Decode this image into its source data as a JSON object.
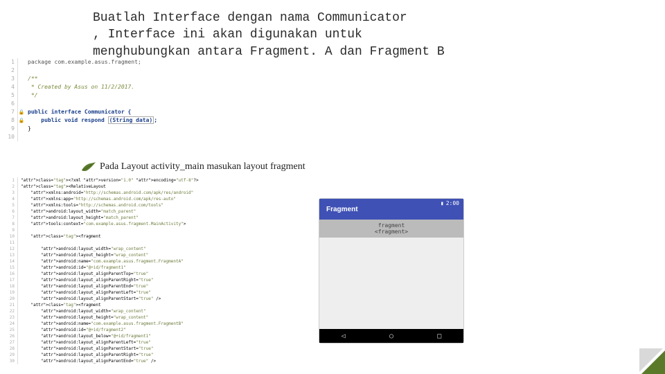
{
  "heading_lines": [
    "Buatlah Interface dengan nama Communicator",
    ", Interface ini akan digunakan untuk",
    "menghubungkan antara Fragment. A dan Fragment B"
  ],
  "subheading": "Pada Layout activity_main masukan layout fragment",
  "code1": {
    "lines": [
      {
        "n": "1",
        "icons": "",
        "txt": "package com.example.asus.fragment;",
        "cls": "pkgline"
      },
      {
        "n": "2",
        "icons": "",
        "txt": "",
        "cls": ""
      },
      {
        "n": "3",
        "icons": "",
        "txt": "/**",
        "cls": "cm"
      },
      {
        "n": "4",
        "icons": "",
        "txt": " * Created by Asus on 11/2/2017.",
        "cls": "cm"
      },
      {
        "n": "5",
        "icons": "",
        "txt": " */",
        "cls": "cm"
      },
      {
        "n": "6",
        "icons": "",
        "txt": "",
        "cls": ""
      },
      {
        "n": "7",
        "icons": "🔒▸",
        "txt": "public interface Communicator {",
        "cls": "kw"
      },
      {
        "n": "8",
        "icons": "🔒",
        "txt": "    public void respond (String data);",
        "cls": "kw",
        "boxed": true
      },
      {
        "n": "9",
        "icons": "",
        "txt": "}",
        "cls": ""
      },
      {
        "n": "10",
        "icons": "",
        "txt": "",
        "cls": ""
      }
    ]
  },
  "code2": {
    "lines": [
      "<?xml version=\"1.0\" encoding=\"utf-8\"?>",
      "<RelativeLayout",
      "    xmlns:android=\"http://schemas.android.com/apk/res/android\"",
      "    xmlns:app=\"http://schemas.android.com/apk/res-auto\"",
      "    xmlns:tools=\"http://schemas.android.com/tools\"",
      "    android:layout_width=\"match_parent\"",
      "    android:layout_height=\"match_parent\"",
      "    tools:context=\"com.example.asus.fragment.MainActivity\">",
      "",
      "    <fragment",
      "",
      "        android:layout_width=\"wrap_content\"",
      "        android:layout_height=\"wrap_content\"",
      "        android:name=\"com.example.asus.fragment.FragmentA\"",
      "        android:id=\"@+id/fragment1\"",
      "        android:layout_alignParentTop=\"true\"",
      "        android:layout_alignParentRight=\"true\"",
      "        android:layout_alignParentEnd=\"true\"",
      "        android:layout_alignParentLeft=\"true\"",
      "        android:layout_alignParentStart=\"true\" />",
      "    <fragment",
      "        android:layout_width=\"wrap_content\"",
      "        android:layout_height=\"wrap_content\"",
      "        android:name=\"com.example.asus.fragment.FragmentB\"",
      "        android:id=\"@+id/fragment2\"",
      "        android:layout_below=\"@+id/fragment1\"",
      "        android:layout_alignParentLeft=\"true\"",
      "        android:layout_alignParentStart=\"true\"",
      "        android:layout_alignParentRight=\"true\"",
      "        android:layout_alignParentEnd=\"true\" />"
    ]
  },
  "preview": {
    "title": "Fragment",
    "time": "2:00",
    "frag_upper": "fragment",
    "frag_lower": "<fragment>",
    "nav": {
      "back": "◁",
      "home": "○",
      "recent": "□"
    }
  }
}
